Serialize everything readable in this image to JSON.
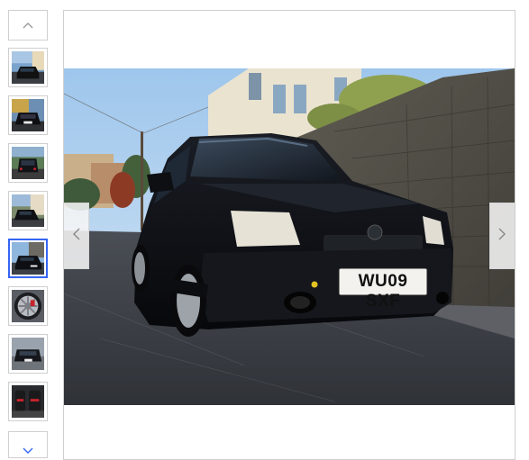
{
  "gallery": {
    "thumbnails": [
      {
        "subject": "car-front-street",
        "selected": false
      },
      {
        "subject": "car-front-close",
        "selected": false
      },
      {
        "subject": "car-rear",
        "selected": false
      },
      {
        "subject": "car-side-house",
        "selected": false
      },
      {
        "subject": "car-front-low",
        "selected": true
      },
      {
        "subject": "alloy-wheel",
        "selected": false
      },
      {
        "subject": "car-front-dark",
        "selected": false
      },
      {
        "subject": "interior-seats",
        "selected": false
      }
    ],
    "scroll_up_icon": "chevron-up-icon",
    "scroll_down_icon": "chevron-down-icon",
    "prev_icon": "chevron-left-icon",
    "next_icon": "chevron-right-icon"
  },
  "main_image": {
    "number_plate": "WU09 SXF"
  },
  "colors": {
    "selected_border": "#3665f3",
    "border": "#cfcfcf",
    "car_body": "#0d0f14"
  }
}
